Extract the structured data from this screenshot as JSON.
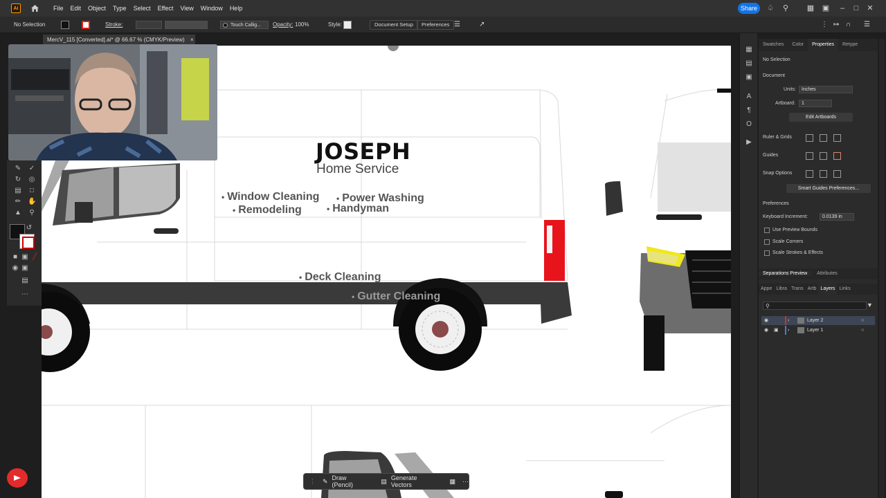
{
  "menubar": {
    "app_logo": "Ai",
    "items": [
      "File",
      "Edit",
      "Object",
      "Type",
      "Select",
      "Effect",
      "View",
      "Window",
      "Help"
    ],
    "share_label": "Share"
  },
  "controlbar": {
    "selection": "No Selection",
    "stroke_label": "Stroke:",
    "brush": "Touch Callig...",
    "opacity_label": "Opacity:",
    "opacity_value": "100%",
    "style_label": "Style:",
    "doc_setup": "Document Setup",
    "preferences": "Preferences"
  },
  "document": {
    "tab_title": "MercV_115 [Converted].ai* @ 66.67 % (CMYK/Preview)"
  },
  "artwork": {
    "brand": "JOSEPH",
    "tagline": "Home Service",
    "services": [
      "Window Cleaning",
      "Power Washing",
      "Remodeling",
      "Handyman",
      "Deck Cleaning",
      "Gutter Cleaning"
    ],
    "colors": {
      "taillight": "#e8141c",
      "headlight": "#f0e81a",
      "stripe": "#3a3a3a"
    }
  },
  "context_bar": {
    "draw_label": "Draw (Pencil)",
    "generate_label": "Generate Vectors"
  },
  "properties_panel": {
    "tabs": [
      "Swatches",
      "Color",
      "Properties",
      "Retype"
    ],
    "active_tab": "Properties",
    "selection": "No Selection",
    "section_document": "Document",
    "units_label": "Units:",
    "units_value": "Inches",
    "artboard_label": "Artboard:",
    "artboard_value": "1",
    "edit_artboards": "Edit Artboards",
    "ruler_grids": "Ruler & Grids",
    "guides": "Guides",
    "snap_options": "Snap Options",
    "smart_guides": "Smart Guides Preferences...",
    "preferences": "Preferences",
    "keyboard_increment_label": "Keyboard Increment:",
    "keyboard_increment_value": "0.0139 in",
    "checkboxes": [
      "Use Preview Bounds",
      "Scale Corners",
      "Scale Strokes & Effects"
    ]
  },
  "layers_panel": {
    "top_tabs": [
      "Separations Preview",
      "Attributes"
    ],
    "tabs": [
      "Appe",
      "Libra",
      "Trans",
      "Artb",
      "Layers",
      "Links"
    ],
    "active_tab": "Layers",
    "layers": [
      "Layer 2",
      "Layer 1"
    ]
  }
}
